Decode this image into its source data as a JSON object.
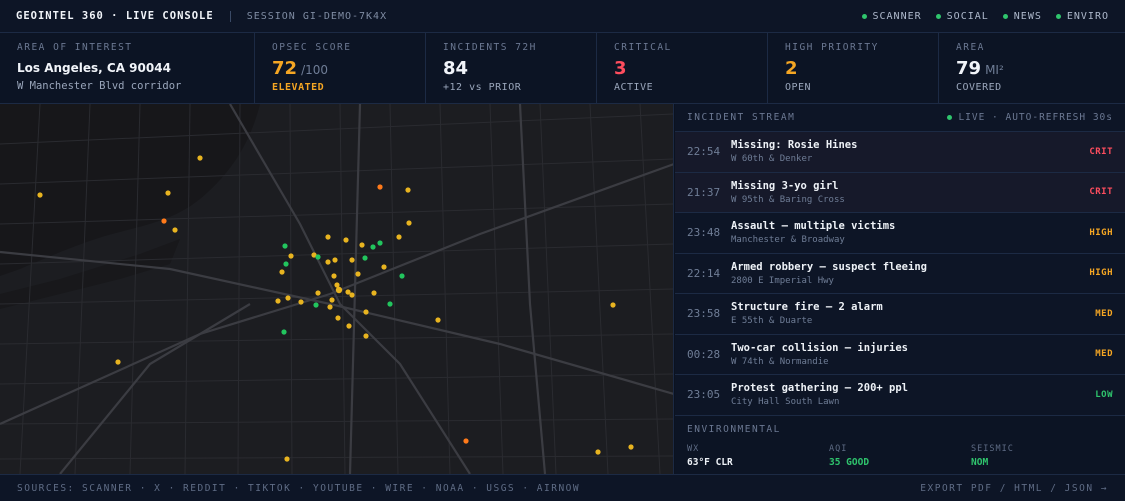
{
  "header": {
    "brand": "GEOINTEL 360 · LIVE CONSOLE",
    "session": "SESSION GI-DEMO-7K4X",
    "feeds": [
      "SCANNER",
      "SOCIAL",
      "NEWS",
      "ENVIRO"
    ]
  },
  "stats": {
    "aoi": {
      "label": "AREA OF INTEREST",
      "title": "Los Angeles, CA 90044",
      "sub": "W Manchester Blvd corridor"
    },
    "opsec": {
      "label": "OPSEC SCORE",
      "value": "72",
      "unit": "/100",
      "sub": "ELEVATED"
    },
    "incidents": {
      "label": "INCIDENTS 72H",
      "value": "84",
      "sub": "+12 vs PRIOR"
    },
    "critical": {
      "label": "CRITICAL",
      "value": "3",
      "sub": "ACTIVE"
    },
    "high": {
      "label": "HIGH PRIORITY",
      "value": "2",
      "sub": "OPEN"
    },
    "area": {
      "label": "AREA",
      "value": "79",
      "unit": "MI²",
      "sub": "COVERED"
    }
  },
  "stream": {
    "title": "INCIDENT STREAM",
    "live": "LIVE · AUTO-REFRESH 30s",
    "items": [
      {
        "time": "22:54",
        "title": "Missing: Rosie Hines",
        "loc": "W 60th & Denker",
        "sev": "CRIT"
      },
      {
        "time": "21:37",
        "title": "Missing 3-yo girl",
        "loc": "W 95th & Baring Cross",
        "sev": "CRIT"
      },
      {
        "time": "23:48",
        "title": "Assault — multiple victims",
        "loc": "Manchester & Broadway",
        "sev": "HIGH"
      },
      {
        "time": "22:14",
        "title": "Armed robbery — suspect fleeing",
        "loc": "2800 E Imperial Hwy",
        "sev": "HIGH"
      },
      {
        "time": "23:58",
        "title": "Structure fire — 2 alarm",
        "loc": "E 55th & Duarte",
        "sev": "MED"
      },
      {
        "time": "00:28",
        "title": "Two-car collision — injuries",
        "loc": "W 74th & Normandie",
        "sev": "MED"
      },
      {
        "time": "23:05",
        "title": "Protest gathering — 200+ ppl",
        "loc": "City Hall South Lawn",
        "sev": "LOW"
      }
    ]
  },
  "env": {
    "title": "ENVIRONMENTAL",
    "items": [
      {
        "label": "WX",
        "value": "63°F CLR"
      },
      {
        "label": "AQI",
        "value": "35 GOOD"
      },
      {
        "label": "SEISMIC",
        "value": "NOM"
      }
    ]
  },
  "footer": {
    "sources": "SOURCES: SCANNER · X · REDDIT · TIKTOK · YOUTUBE · WIRE · NOAA · USGS · AIRNOW",
    "exports": "EXPORT PDF / HTML / JSON →"
  },
  "colors": {
    "orange": "#f5a623",
    "red": "#ff4d5e",
    "green": "#2fc56d",
    "marker_yellow": "#e8b420",
    "marker_orange": "#ff7a1a",
    "marker_green": "#22c55e"
  }
}
